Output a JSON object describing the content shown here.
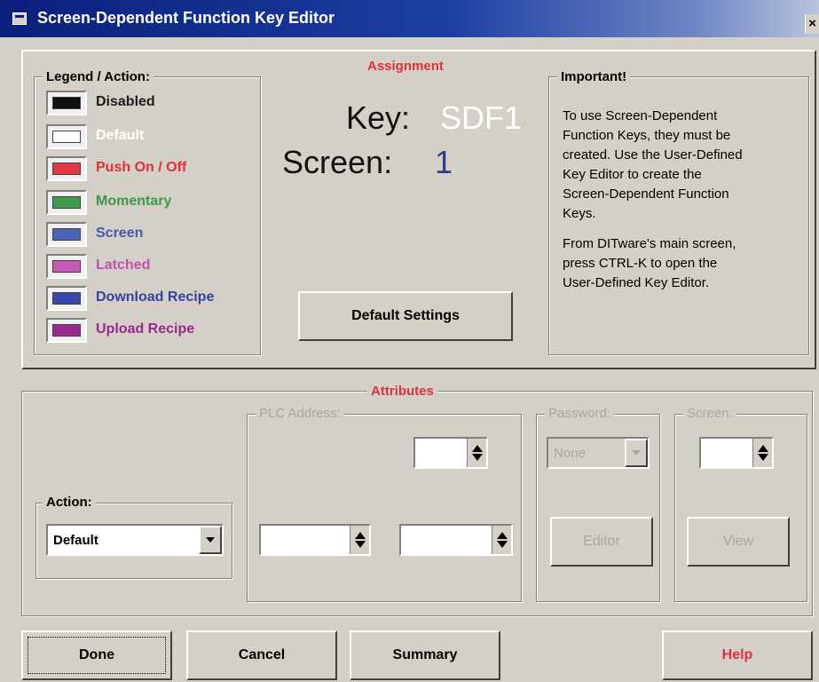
{
  "window": {
    "title": "Screen-Dependent Function Key Editor",
    "close_glyph": "×"
  },
  "legend": {
    "title": "Legend / Action:",
    "items": [
      {
        "label": "Disabled",
        "color": "#101010",
        "text_color": "#1a1a1a"
      },
      {
        "label": "Default",
        "color": "#ffffff",
        "text_color": "#ffffff"
      },
      {
        "label": "Push On / Off",
        "color": "#e23a45",
        "text_color": "#e0303a"
      },
      {
        "label": "Momentary",
        "color": "#3f9a4c",
        "text_color": "#3a9a4a"
      },
      {
        "label": "Screen",
        "color": "#4a64b8",
        "text_color": "#3f58b0"
      },
      {
        "label": "Latched",
        "color": "#c45ab4",
        "text_color": "#c050b0"
      },
      {
        "label": "Download Recipe",
        "color": "#3848a8",
        "text_color": "#34449e"
      },
      {
        "label": "Upload Recipe",
        "color": "#9a2a90",
        "text_color": "#98288e"
      }
    ]
  },
  "assignment": {
    "title": "Assignment",
    "key_label": "Key:",
    "key_value": "SDF1",
    "screen_label": "Screen:",
    "screen_value": "1",
    "default_settings_button": "Default Settings"
  },
  "important": {
    "title": "Important!",
    "paragraph1": "To use Screen-Dependent\nFunction Keys, they must be\ncreated.  Use the User-Defined\nKey Editor to create the\nScreen-Dependent Function\nKeys.",
    "paragraph2": "From DITware's main screen,\npress CTRL-K to open the\nUser-Defined Key Editor."
  },
  "attributes": {
    "title": "Attributes",
    "action_label": "Action:",
    "action_value": "Default",
    "plc_label": "PLC Address:",
    "password_label": "Password:",
    "password_value": "None",
    "editor_button": "Editor",
    "screen_label": "Screen:",
    "view_button": "View"
  },
  "footer": {
    "done": "Done",
    "cancel": "Cancel",
    "summary": "Summary",
    "help": "Help"
  },
  "colors": {
    "accent_red": "#e0303a",
    "screen_value_blue": "#2b3c8c",
    "title_bar": "#0a1f7a",
    "face": "#d4d0c8"
  }
}
